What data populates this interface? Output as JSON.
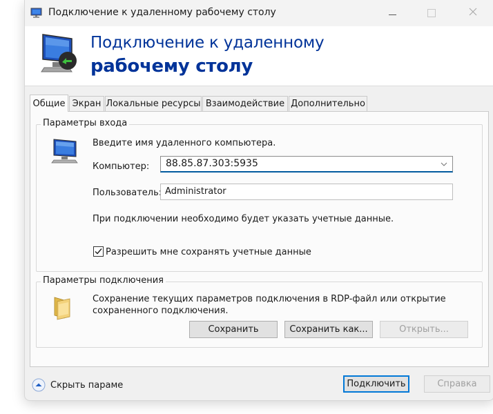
{
  "window": {
    "title": "Подключение к удаленному рабочему столу"
  },
  "banner": {
    "line1": "Подключение к удаленному",
    "line2": "рабочему столу"
  },
  "tabs": [
    {
      "label": "Общие",
      "active": true
    },
    {
      "label": "Экран",
      "active": false
    },
    {
      "label": "Локальные ресурсы",
      "active": false
    },
    {
      "label": "Взаимодействие",
      "active": false
    },
    {
      "label": "Дополнительно",
      "active": false
    }
  ],
  "logon": {
    "group_title": "Параметры входа",
    "instruction": "Введите имя удаленного компьютера.",
    "computer_label": "Компьютер:",
    "computer_value": "88.85.87.303:5935",
    "user_label": "Пользователь:",
    "user_value": "Administrator",
    "credentials_note": "При подключении необходимо будет указать учетные данные.",
    "save_credentials_label": "Разрешить мне сохранять учетные данные",
    "save_credentials_checked": true
  },
  "connection": {
    "group_title": "Параметры подключения",
    "description_line1": "Сохранение текущих параметров подключения в RDP-файл или открытие",
    "description_line2": "сохраненного подключения.",
    "save_label": "Сохранить",
    "save_as_label": "Сохранить как...",
    "open_label": "Открыть..."
  },
  "footer": {
    "hide_options_label": "Скрыть параме",
    "connect_label": "Подключить",
    "help_label": "Справка"
  },
  "colors": {
    "banner_text": "#003399",
    "focus_accent": "#005a9e",
    "default_button_border": "#0078d7"
  }
}
